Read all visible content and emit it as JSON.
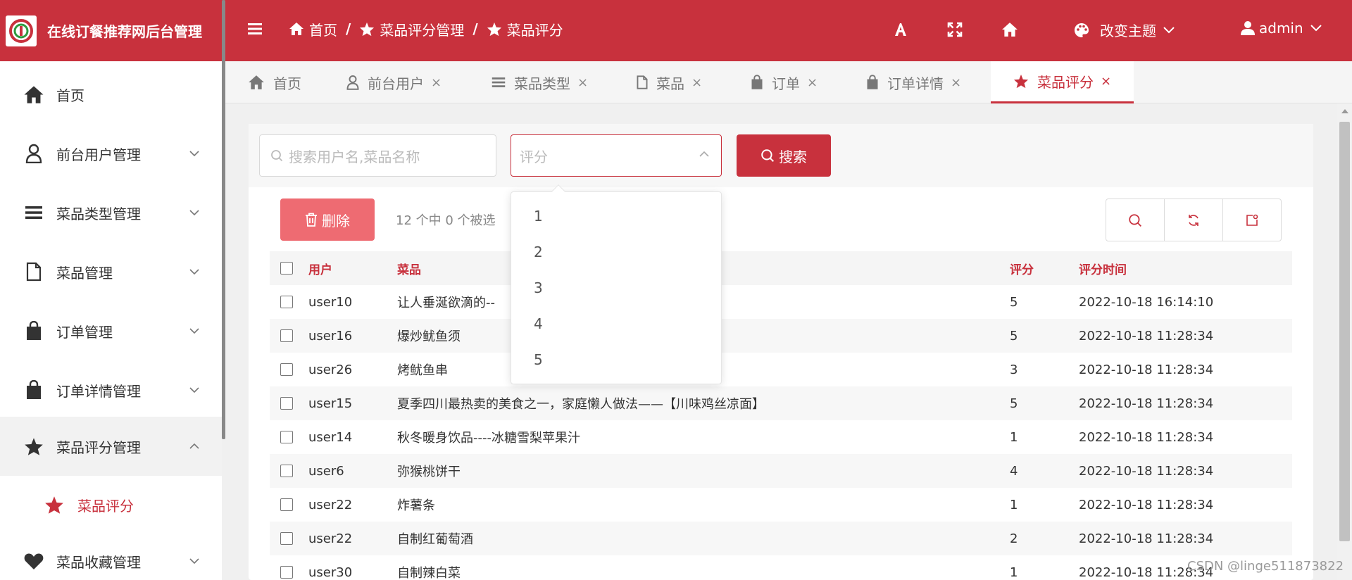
{
  "app": {
    "title": "在线订餐推荐网后台管理"
  },
  "breadcrumb": [
    {
      "label": "首页",
      "icon": "home-icon"
    },
    {
      "label": "菜品评分管理",
      "icon": "star-icon"
    },
    {
      "label": "菜品评分",
      "icon": "star-icon"
    }
  ],
  "header": {
    "theme_label": "改变主题",
    "user_label": "admin"
  },
  "sidebar": {
    "items": [
      {
        "label": "首页",
        "icon": "home-icon"
      },
      {
        "label": "前台用户管理",
        "icon": "user-icon"
      },
      {
        "label": "菜品类型管理",
        "icon": "list-icon"
      },
      {
        "label": "菜品管理",
        "icon": "file-icon"
      },
      {
        "label": "订单管理",
        "icon": "bag-icon"
      },
      {
        "label": "订单详情管理",
        "icon": "bag-icon"
      },
      {
        "label": "菜品评分管理",
        "icon": "star-icon"
      },
      {
        "label": "菜品收藏管理",
        "icon": "heart-icon"
      }
    ],
    "sub_item": {
      "label": "菜品评分",
      "icon": "star-icon"
    }
  },
  "tabs": [
    {
      "label": "首页",
      "icon": "home-icon"
    },
    {
      "label": "前台用户",
      "icon": "user-icon"
    },
    {
      "label": "菜品类型",
      "icon": "list-icon"
    },
    {
      "label": "菜品",
      "icon": "file-icon"
    },
    {
      "label": "订单",
      "icon": "bag-icon"
    },
    {
      "label": "订单详情",
      "icon": "bag-icon"
    },
    {
      "label": "菜品评分",
      "icon": "star-icon"
    }
  ],
  "tab_close_glyph": "×",
  "filter": {
    "search_placeholder": "搜索用户名,菜品名称",
    "rating_placeholder": "评分",
    "search_button": "搜索",
    "rating_options": [
      "1",
      "2",
      "3",
      "4",
      "5"
    ]
  },
  "toolbar": {
    "delete_label": "删除",
    "selection_info": "12 个中 0 个被选"
  },
  "table": {
    "headers": {
      "user": "用户",
      "dish": "菜品",
      "rating": "评分",
      "time": "评分时间"
    },
    "rows": [
      {
        "user": "user10",
        "dish": "让人垂涎欲滴的--",
        "rating": "5",
        "time": "2022-10-18 16:14:10"
      },
      {
        "user": "user16",
        "dish": "爆炒鱿鱼须",
        "rating": "5",
        "time": "2022-10-18 11:28:34"
      },
      {
        "user": "user26",
        "dish": "烤鱿鱼串",
        "rating": "3",
        "time": "2022-10-18 11:28:34"
      },
      {
        "user": "user15",
        "dish": "夏季四川最热卖的美食之一，家庭懒人做法——【川味鸡丝凉面】",
        "rating": "5",
        "time": "2022-10-18 11:28:34"
      },
      {
        "user": "user14",
        "dish": "秋冬暖身饮品----冰糖雪梨苹果汁",
        "rating": "1",
        "time": "2022-10-18 11:28:34"
      },
      {
        "user": "user6",
        "dish": "弥猴桃饼干",
        "rating": "4",
        "time": "2022-10-18 11:28:34"
      },
      {
        "user": "user22",
        "dish": "炸薯条",
        "rating": "1",
        "time": "2022-10-18 11:28:34"
      },
      {
        "user": "user22",
        "dish": "自制红葡萄酒",
        "rating": "2",
        "time": "2022-10-18 11:28:34"
      },
      {
        "user": "user30",
        "dish": "自制辣白菜",
        "rating": "1",
        "time": "2022-10-18 11:28:34"
      }
    ]
  },
  "watermark": "CSDN @linge511873822",
  "colors": {
    "accent": "#c8313d",
    "delete": "#ee6b72"
  }
}
